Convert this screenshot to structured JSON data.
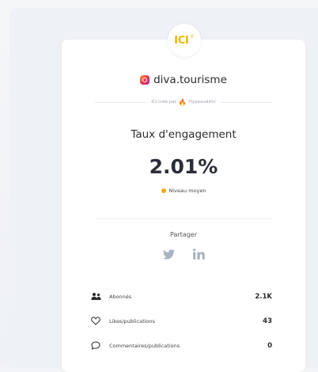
{
  "brand": {
    "logo_text": "ICI"
  },
  "account": {
    "handle": "diva.tourisme",
    "platform_icon": "instagram-icon"
  },
  "made_by": {
    "text": "ICI créé par",
    "tool": "Hypeauditor"
  },
  "metric": {
    "title": "Taux d'engagement",
    "value": "2.01%",
    "level_label": "Niveau moyen",
    "level_color": "#f3a81a"
  },
  "share": {
    "label": "Partager",
    "networks": [
      "twitter-icon",
      "linkedin-icon"
    ]
  },
  "stats": [
    {
      "icon": "followers-icon",
      "label": "Abonnés",
      "value": "2.1K"
    },
    {
      "icon": "heart-icon",
      "label": "Likes/publications",
      "value": "43"
    },
    {
      "icon": "comment-icon",
      "label": "Commentaires/publications",
      "value": "0"
    }
  ],
  "colors": {
    "accent": "#f3b400",
    "instagram": "#e8364f",
    "hypeauditor": "#f05a28",
    "muted_icon": "#a9b3c1"
  }
}
